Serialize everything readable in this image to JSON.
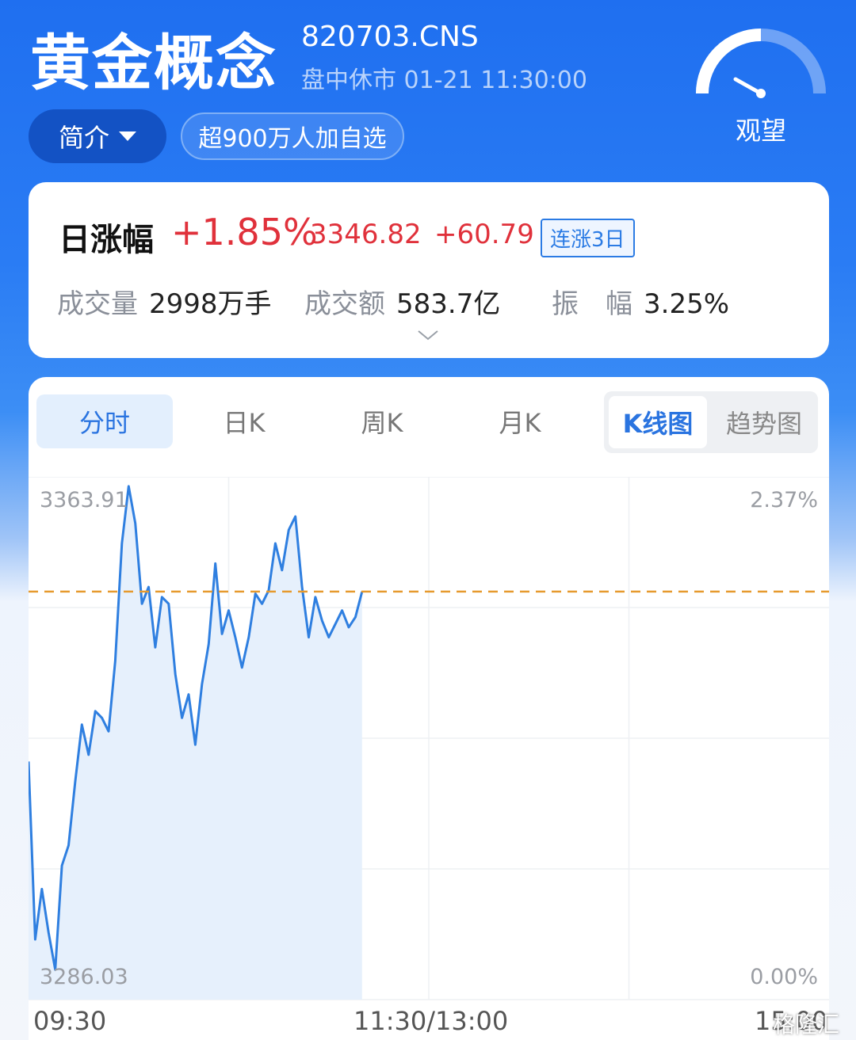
{
  "header": {
    "title": "黄金概念",
    "code": "820703.CNS",
    "status": "盘中休市  01-21 11:30:00",
    "intro_button": "简介",
    "favorites_badge": "超900万人加自选",
    "sentiment": "观望"
  },
  "quote": {
    "label": "日涨幅",
    "change_pct": "+1.85%",
    "price": "3346.82",
    "change": "+60.79",
    "streak_badge": "连涨3日",
    "stats": [
      {
        "key": "成交量",
        "value": "2998万手"
      },
      {
        "key": "成交额",
        "value": "583.7亿"
      },
      {
        "key": "振　幅",
        "value": "3.25%"
      }
    ],
    "colors": {
      "up": "#e0313b",
      "accent": "#2a74e0"
    }
  },
  "chart_tabs": {
    "tabs": [
      "分时",
      "日K",
      "周K",
      "月K"
    ],
    "active": "分时",
    "view_toggle": [
      "K线图",
      "趋势图"
    ],
    "view_active": "K线图"
  },
  "chart_data": {
    "type": "line",
    "title": "",
    "y_left_labels": {
      "top": "3363.91",
      "bottom": "3286.03"
    },
    "y_right_labels": {
      "top": "2.37%",
      "bottom": "0.00%"
    },
    "ylim": [
      3286.03,
      3363.91
    ],
    "prev_close_line": 3346.82,
    "x_ticks": [
      "09:30",
      "11:30/13:00",
      "15:00"
    ],
    "x_minutes": [
      0,
      2,
      4,
      6,
      8,
      10,
      12,
      14,
      16,
      18,
      20,
      22,
      24,
      26,
      28,
      30,
      32,
      34,
      36,
      38,
      40,
      42,
      44,
      46,
      48,
      50,
      52,
      54,
      56,
      58,
      60,
      62,
      64,
      66,
      68,
      70,
      72,
      74,
      76,
      78,
      80,
      82,
      84,
      86,
      88,
      90,
      92,
      94,
      96,
      98,
      100,
      102,
      104,
      106,
      108,
      110,
      112,
      114,
      116,
      118,
      120
    ],
    "values": [
      3321.5,
      3295.0,
      3302.5,
      3296.0,
      3290.5,
      3306.0,
      3309.0,
      3318.5,
      3327.0,
      3322.5,
      3329.0,
      3328.0,
      3326.0,
      3336.5,
      3354.0,
      3362.5,
      3357.0,
      3345.0,
      3347.5,
      3338.5,
      3346.0,
      3345.0,
      3334.5,
      3328.0,
      3331.5,
      3324.0,
      3333.0,
      3339.0,
      3351.0,
      3340.5,
      3344.0,
      3340.0,
      3335.5,
      3340.0,
      3346.5,
      3345.0,
      3347.0,
      3354.0,
      3350.0,
      3356.0,
      3358.0,
      3347.5,
      3340.0,
      3346.0,
      3342.5,
      3340.0,
      3342.0,
      3344.0,
      3341.5,
      3343.0,
      3346.8,
      null,
      null,
      null,
      null,
      null,
      null,
      null,
      null,
      null,
      null
    ]
  },
  "watermark": "格隆汇"
}
